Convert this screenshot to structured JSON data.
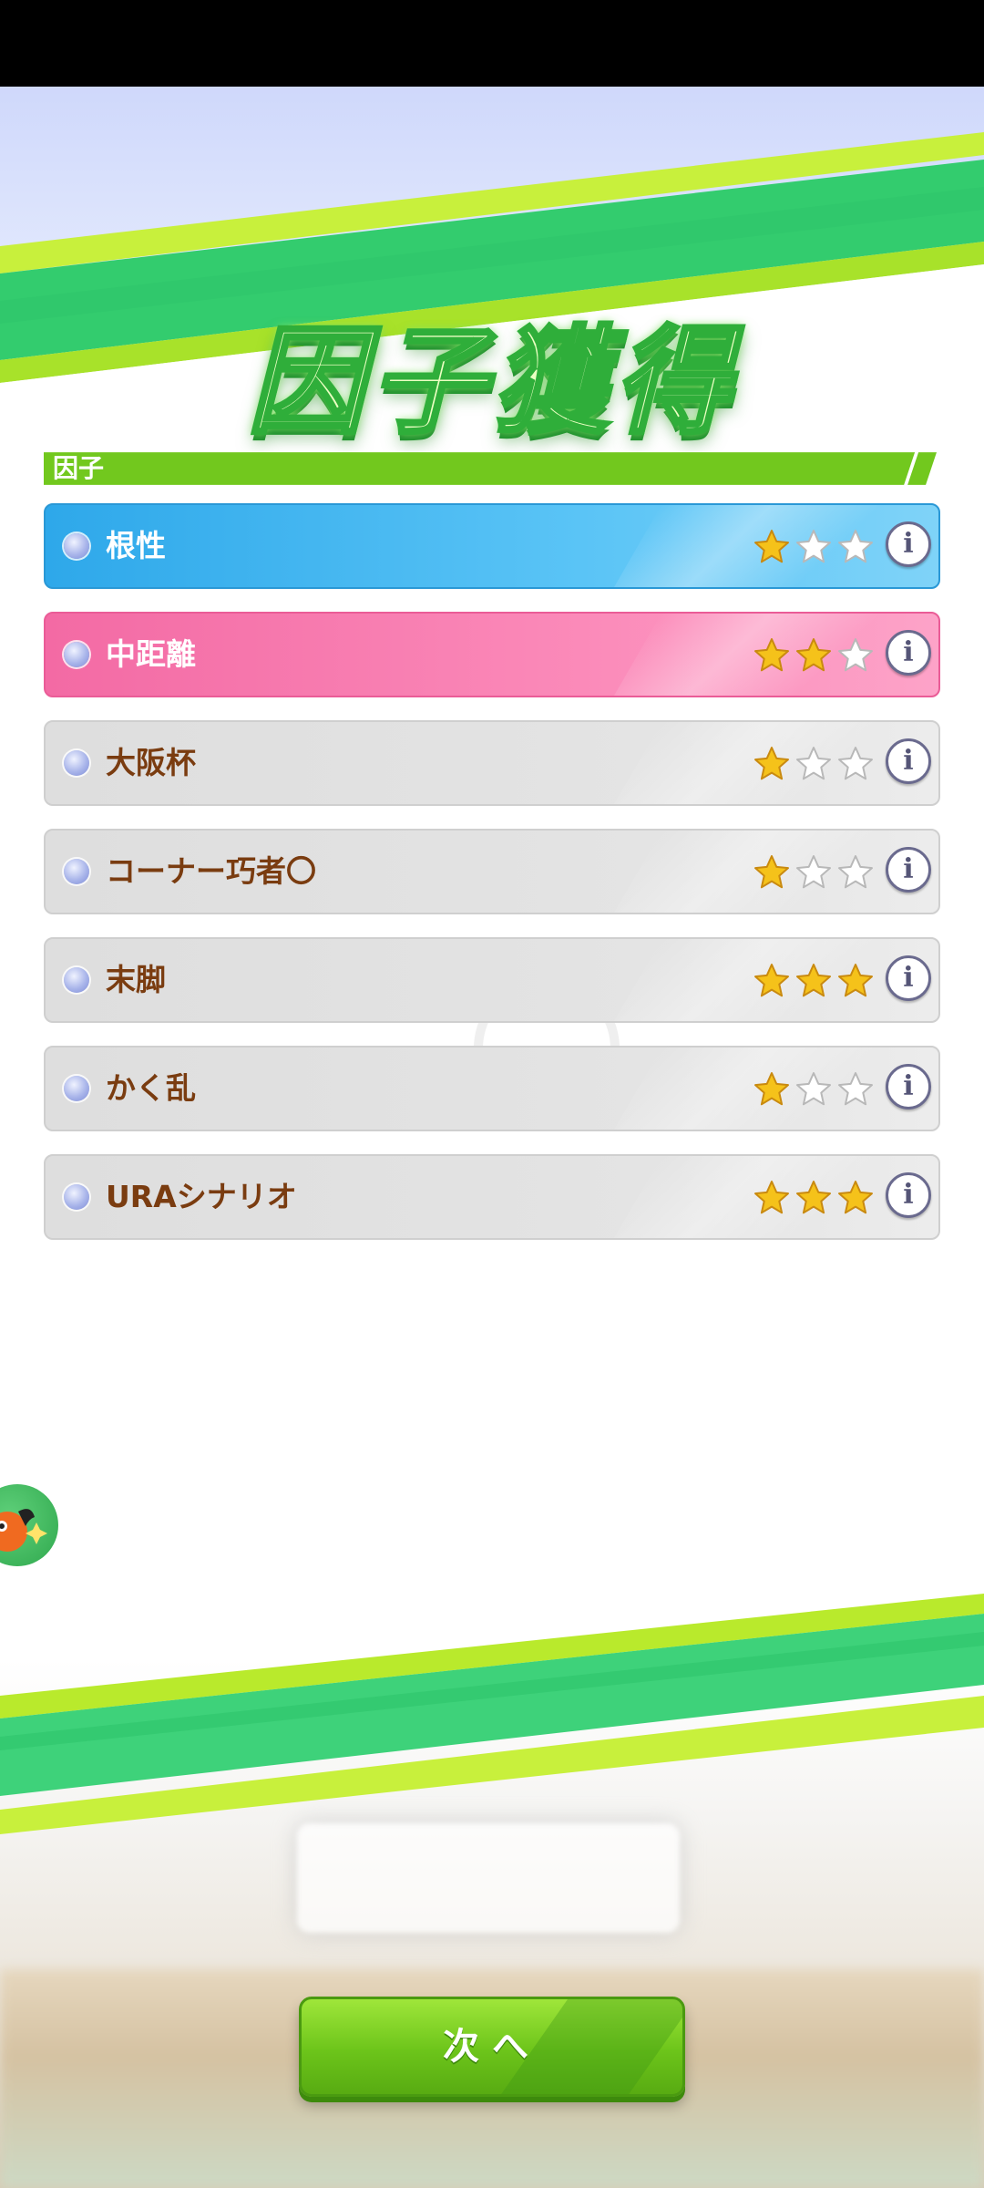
{
  "title": "因子獲得",
  "section": {
    "label": "因子"
  },
  "factors": [
    {
      "name": "根性",
      "stars": 1,
      "max_stars": 3,
      "color": "blue"
    },
    {
      "name": "中距離",
      "stars": 2,
      "max_stars": 3,
      "color": "pink"
    },
    {
      "name": "大阪杯",
      "stars": 1,
      "max_stars": 3,
      "color": "gray"
    },
    {
      "name": "コーナー巧者〇",
      "stars": 1,
      "max_stars": 3,
      "color": "gray"
    },
    {
      "name": "末脚",
      "stars": 3,
      "max_stars": 3,
      "color": "gray"
    },
    {
      "name": "かく乱",
      "stars": 1,
      "max_stars": 3,
      "color": "gray"
    },
    {
      "name": "URAシナリオ",
      "stars": 3,
      "max_stars": 3,
      "color": "gray"
    }
  ],
  "info_icon_glyph": "i",
  "next_button": {
    "label": "次へ"
  },
  "colors": {
    "accent_green": "#6cc41a",
    "blue_factor": "#2ea8ea",
    "pink_factor": "#f36aa4",
    "gray_factor": "#dedede",
    "label_brown": "#7a3c10",
    "star_gold": "#f5c21a"
  },
  "icons": {
    "info": "info-icon",
    "star": "star-icon",
    "bullet": "bullet-icon"
  }
}
